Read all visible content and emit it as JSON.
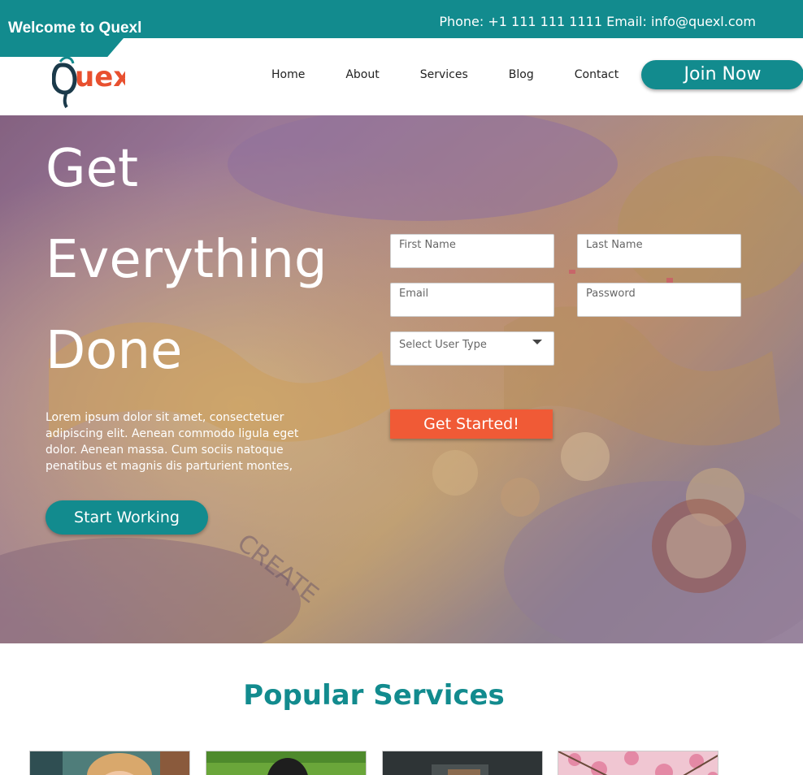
{
  "topbar": {
    "welcome": "Welcome to Quexl",
    "contact": "Phone: +1 111 111 1111 Email: info@quexl.com"
  },
  "brand": {
    "logo_text": "Quexl",
    "accent": "#128b8e",
    "logo_color": "#e8502f"
  },
  "nav": {
    "items": [
      {
        "label": "Home"
      },
      {
        "label": "About"
      },
      {
        "label": "Services"
      },
      {
        "label": "Blog"
      },
      {
        "label": "Contact"
      }
    ],
    "join_label": "Join Now"
  },
  "hero": {
    "title_lines": [
      "Get",
      "Everything",
      "Done"
    ],
    "description": "Lorem ipsum dolor sit amet, consectetuer adipiscing elit. Aenean commodo ligula eget dolor. Aenean massa. Cum sociis natoque penatibus et magnis dis parturient montes,",
    "start_label": "Start Working"
  },
  "form": {
    "first_name_placeholder": "First Name",
    "last_name_placeholder": "Last Name",
    "email_placeholder": "Email",
    "password_placeholder": "Password",
    "user_type_selected": "Select User Type",
    "submit_label": "Get Started!",
    "submit_color": "#f05a36"
  },
  "services": {
    "title": "Popular Services",
    "cards": [
      {
        "image": "woman-portrait"
      },
      {
        "image": "person-on-grass"
      },
      {
        "image": "dark-desk"
      },
      {
        "image": "cherry-blossom"
      }
    ]
  }
}
